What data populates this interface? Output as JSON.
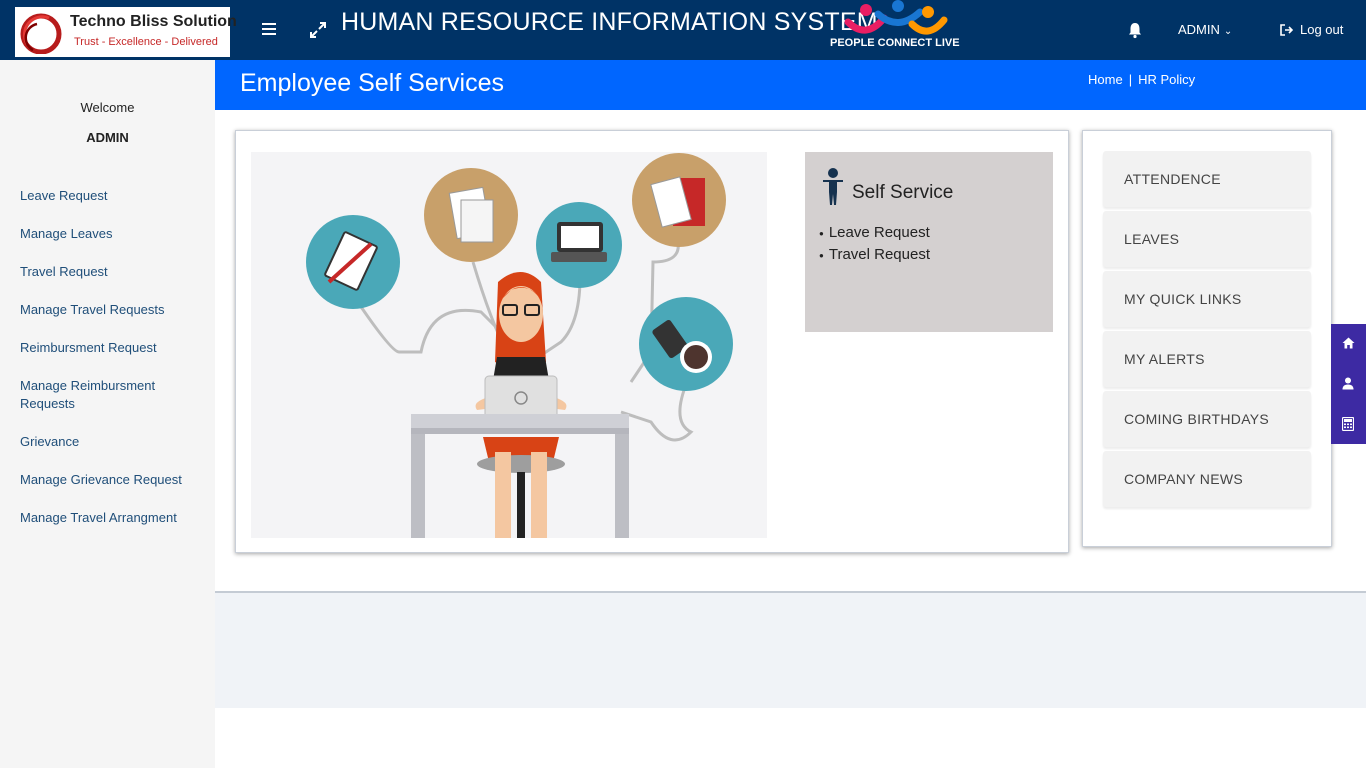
{
  "branding": {
    "company_name": "Techno Bliss Solution",
    "company_tagline": "Trust - Excellence - Delivered",
    "app_title": "HUMAN RESOURCE INFORMATION SYSTEM",
    "product_name": "PEOPLE CONNECT LIVE"
  },
  "topbar": {
    "user_menu_label": "ADMIN",
    "logout_label": "Log out",
    "icons": [
      "menu-icon",
      "expand-icon",
      "bell-icon",
      "chevron-down-icon",
      "logout-icon"
    ]
  },
  "sidebar": {
    "welcome_label": "Welcome",
    "user_name": "ADMIN",
    "items": [
      {
        "label": "Leave Request"
      },
      {
        "label": "Manage Leaves"
      },
      {
        "label": "Travel Request"
      },
      {
        "label": "Manage Travel Requests"
      },
      {
        "label": "Reimbursment Request"
      },
      {
        "label": "Manage Reimbursment Requests"
      },
      {
        "label": "Grievance"
      },
      {
        "label": "Manage Grievance Request"
      },
      {
        "label": "Manage Travel Arrangment"
      }
    ]
  },
  "page_header": {
    "title": "Employee Self Services",
    "breadcrumb": [
      {
        "label": "Home"
      },
      {
        "label": "HR Policy"
      }
    ],
    "separator": "|"
  },
  "self_service": {
    "title": "Self Service",
    "links": [
      {
        "label": "Leave Request"
      },
      {
        "label": "Travel Request"
      }
    ]
  },
  "quick_tiles": [
    {
      "label": "ATTENDENCE"
    },
    {
      "label": "LEAVES"
    },
    {
      "label": "MY QUICK LINKS"
    },
    {
      "label": "MY ALERTS"
    },
    {
      "label": "COMING BIRTHDAYS"
    },
    {
      "label": "COMPANY NEWS"
    }
  ],
  "floating_bar": {
    "icons": [
      "home-icon",
      "user-icon",
      "calculator-icon"
    ]
  },
  "colors": {
    "topbar_bg": "#003366",
    "header_blue": "#0066ff",
    "sidebar_bg": "#f5f5f5",
    "link_color": "#1f4e79",
    "floatbar_bg": "#3d2aa3",
    "self_service_bg": "#d4d0d0",
    "tile_bg": "#f2f2f2"
  }
}
